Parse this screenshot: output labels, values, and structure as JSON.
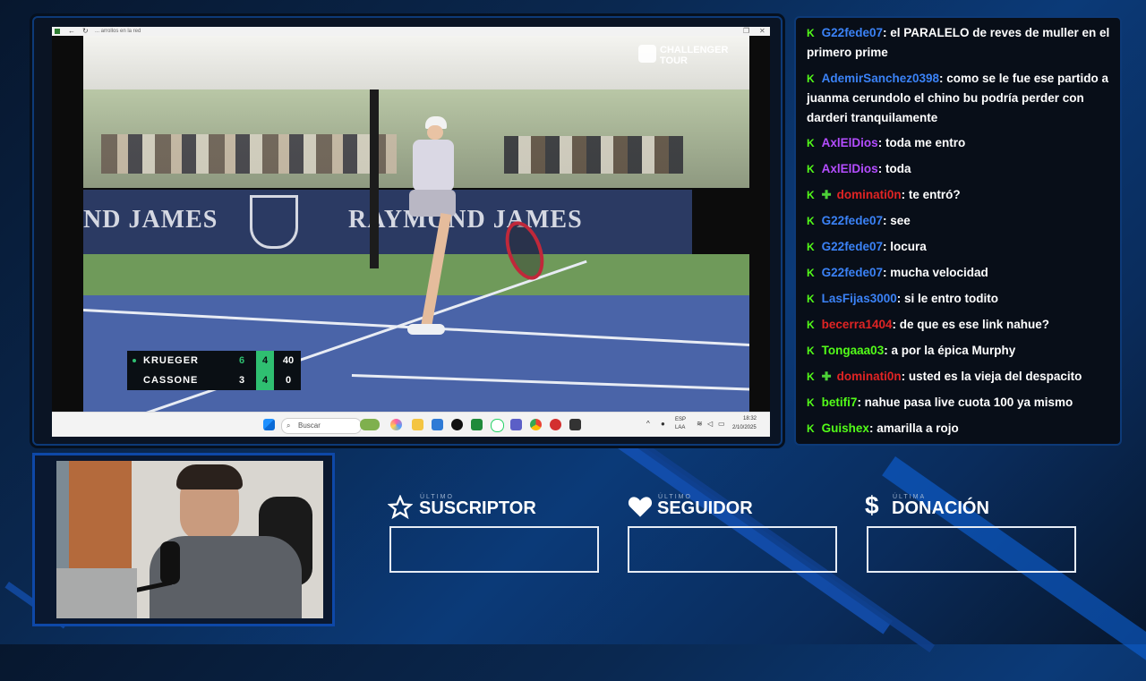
{
  "stream": {
    "browser_tab_title": "... arrollos en la red",
    "watermark": "CHALLENGER TOUR",
    "sponsor_banner": "RAYMOND JAMES",
    "sponsor_banner_left": "ND JAMES"
  },
  "scoreboard": {
    "players": [
      {
        "name": "KRUEGER",
        "sets": "6",
        "games": "4",
        "points": "40",
        "serving": true
      },
      {
        "name": "CASSONE",
        "sets": "3",
        "games": "4",
        "points": "0",
        "serving": false
      }
    ]
  },
  "taskbar": {
    "search_placeholder": "Buscar",
    "lang": "ESP",
    "lang2": "LAA",
    "time": "18:32",
    "date": "2/10/2025"
  },
  "chat": {
    "messages": [
      {
        "user": "G22fede07",
        "color": "#3b82f6",
        "text": ": el PARALELO de reves de muller en el primero prime",
        "extra_badge": false
      },
      {
        "user": "AdemirSanchez0398",
        "color": "#3b82f6",
        "text": ": como se le fue ese partido a juanma cerundolo el chino bu podría perder con darderi tranquilamente",
        "extra_badge": false
      },
      {
        "user": "AxlElDios",
        "color": "#b44dff",
        "text": ": toda me entro",
        "extra_badge": false
      },
      {
        "user": "AxlElDios",
        "color": "#b44dff",
        "text": ": toda",
        "extra_badge": false
      },
      {
        "user": "dominati0n",
        "color": "#e02424",
        "text": ": te entró?",
        "extra_badge": true
      },
      {
        "user": "G22fede07",
        "color": "#3b82f6",
        "text": ": see",
        "extra_badge": false
      },
      {
        "user": "G22fede07",
        "color": "#3b82f6",
        "text": ": locura",
        "extra_badge": false
      },
      {
        "user": "G22fede07",
        "color": "#3b82f6",
        "text": ": mucha velocidad",
        "extra_badge": false
      },
      {
        "user": "LasFijas3000",
        "color": "#3b82f6",
        "text": ": si le entro todito",
        "extra_badge": false
      },
      {
        "user": "becerra1404",
        "color": "#e02424",
        "text": ": de que es ese link nahue?",
        "extra_badge": false
      },
      {
        "user": "Tongaaa03",
        "color": "#53fc18",
        "text": ": a por la épica Murphy",
        "extra_badge": false
      },
      {
        "user": "dominati0n",
        "color": "#e02424",
        "text": ": usted es la vieja del despacito",
        "extra_badge": true
      },
      {
        "user": "betifi7",
        "color": "#53fc18",
        "text": ": nahue pasa live cuota 100 ya mismo",
        "extra_badge": false
      },
      {
        "user": "Guishex",
        "color": "#53fc18",
        "text": ": amarilla a rojo",
        "extra_badge": false
      }
    ]
  },
  "alerts": [
    {
      "sub": "ÚLTIMO",
      "title": "SUSCRIPTOR",
      "icon": "star-icon",
      "value": ""
    },
    {
      "sub": "ÚLTIMO",
      "title": "SEGUIDOR",
      "icon": "heart-icon",
      "value": ""
    },
    {
      "sub": "ÚLTIMA",
      "title": "DONACIÓN",
      "icon": "dollar-icon",
      "value": ""
    }
  ],
  "colors": {
    "kick_green": "#53fc18",
    "frame_blue": "#0d3a78",
    "score_green": "#2fbf71"
  }
}
